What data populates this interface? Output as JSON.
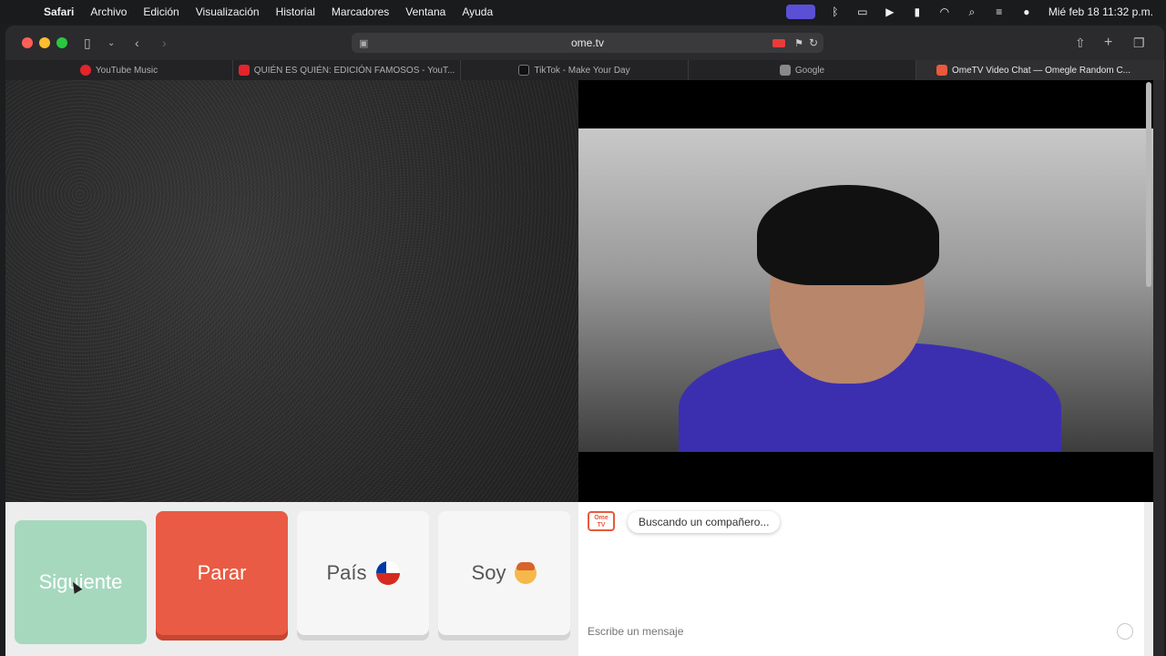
{
  "menubar": {
    "apple_icon": "apple-icon",
    "app": "Safari",
    "items": [
      "Archivo",
      "Edición",
      "Visualización",
      "Historial",
      "Marcadores",
      "Ventana",
      "Ayuda"
    ],
    "clock": "Mié feb 18  11:32 p.m."
  },
  "browser": {
    "url": "ome.tv",
    "tabs": [
      {
        "title": "YouTube Music",
        "favicon": "youtube-music-icon"
      },
      {
        "title": "QUIÉN ES QUIÉN: EDICIÓN FAMOSOS - YouT...",
        "favicon": "youtube-icon"
      },
      {
        "title": "TikTok - Make Your Day",
        "favicon": "tiktok-icon"
      },
      {
        "title": "Google",
        "favicon": "google-icon"
      },
      {
        "title": "OmeTV Video Chat — Omegle Random C...",
        "favicon": "ometv-icon"
      }
    ],
    "active_tab_index": 4
  },
  "controls": {
    "next_label": "Siguiente",
    "stop_label": "Parar",
    "country_label": "País",
    "gender_label": "Soy"
  },
  "chat": {
    "status_message": "Buscando un compañero...",
    "input_placeholder": "Escribe un mensaje",
    "logo_text": "Ome TV"
  },
  "colors": {
    "next": "#a6d8be",
    "stop": "#e95b44",
    "neutral_button": "#f6f6f6",
    "accent": "#e85a3b"
  }
}
